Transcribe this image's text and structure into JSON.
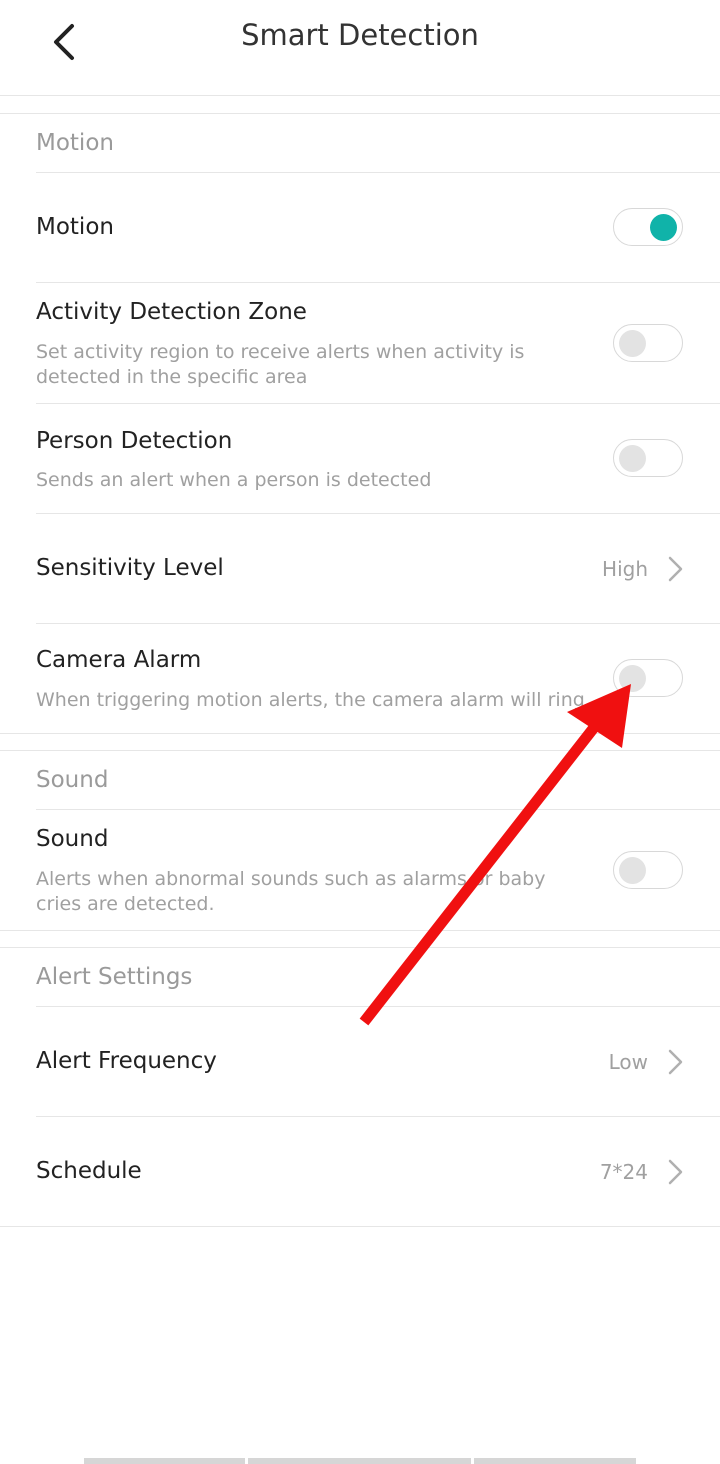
{
  "header": {
    "title": "Smart Detection",
    "back_icon": "chevron-left-icon"
  },
  "motion_section": {
    "title": "Motion",
    "rows": {
      "motion": {
        "title": "Motion",
        "enabled": true
      },
      "activity_zone": {
        "title": "Activity Detection Zone",
        "description": "Set activity region to receive alerts when activity is detected in the specific area",
        "enabled": false
      },
      "person_detection": {
        "title": "Person Detection",
        "description": "Sends an alert when a person is detected",
        "enabled": false
      },
      "sensitivity": {
        "title": "Sensitivity Level",
        "value": "High"
      },
      "camera_alarm": {
        "title": "Camera Alarm",
        "description": "When triggering motion alerts, the camera alarm will ring.",
        "enabled": false
      }
    }
  },
  "sound_section": {
    "title": "Sound",
    "rows": {
      "sound": {
        "title": "Sound",
        "description": "Alerts when abnormal sounds such as alarms or baby cries are detected.",
        "enabled": false
      }
    }
  },
  "alert_section": {
    "title": "Alert Settings",
    "rows": {
      "frequency": {
        "title": "Alert Frequency",
        "value": "Low"
      },
      "schedule": {
        "title": "Schedule",
        "value": "7*24"
      }
    }
  },
  "colors": {
    "accent": "#10b3a9",
    "annotation_arrow": "#f01010",
    "secondary_text": "#a0a0a0"
  }
}
